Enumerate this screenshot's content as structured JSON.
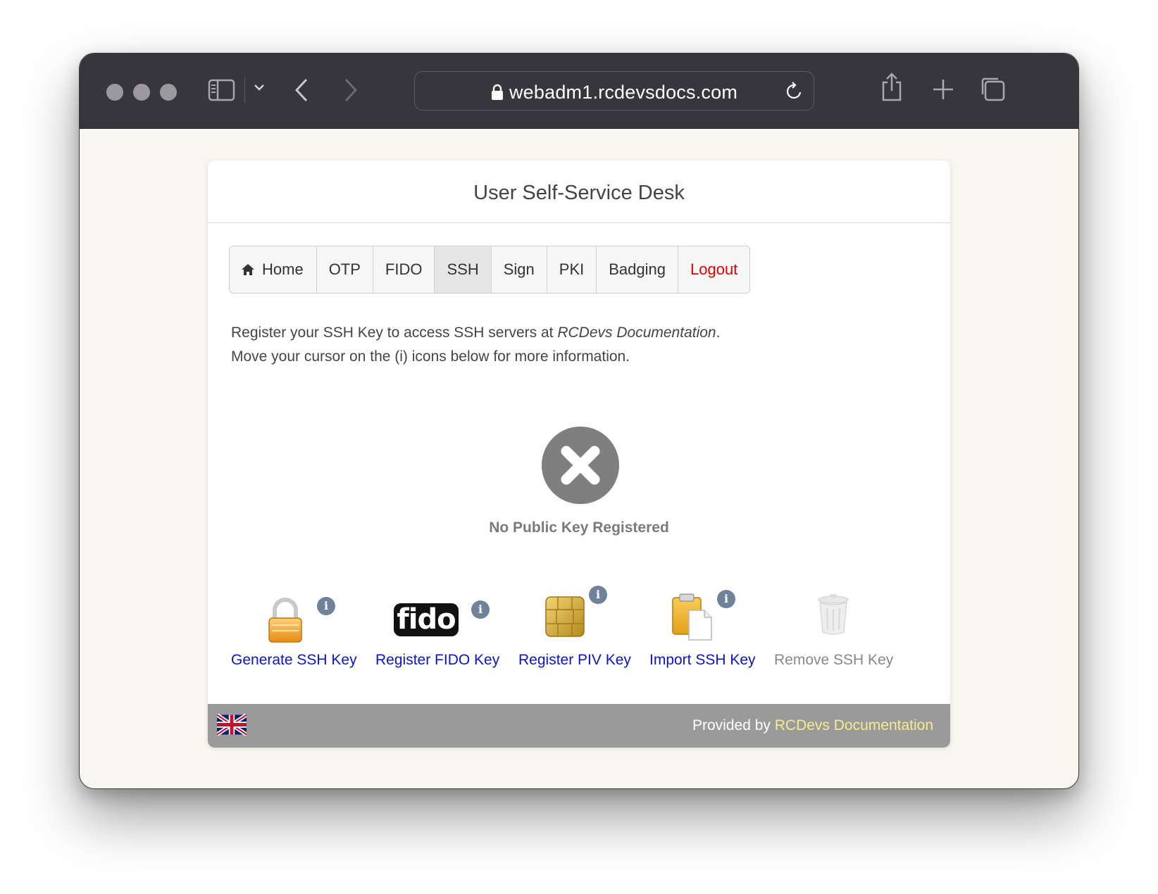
{
  "browser": {
    "url": "webadm1.rcdevsdocs.com",
    "icons": [
      "sidebar-icon",
      "chevron-down-icon",
      "back-icon",
      "forward-icon",
      "lock-icon",
      "reload-icon",
      "share-icon",
      "new-tab-icon",
      "tabs-overview-icon"
    ]
  },
  "page": {
    "title": "User Self-Service Desk",
    "tabs": [
      {
        "label": "Home",
        "icon": "home-icon"
      },
      {
        "label": "OTP"
      },
      {
        "label": "FIDO"
      },
      {
        "label": "SSH",
        "active": true
      },
      {
        "label": "Sign"
      },
      {
        "label": "PKI"
      },
      {
        "label": "Badging"
      },
      {
        "label": "Logout",
        "color": "#e00000"
      }
    ],
    "intro_line1_prefix": "Register your SSH Key to access SSH servers at ",
    "intro_line1_org": "RCDevs Documentation",
    "intro_line1_suffix": ".",
    "intro_line2": "Move your cursor on the (i) icons below for more information.",
    "status": "No Public Key Registered",
    "actions": [
      {
        "label": "Generate SSH Key",
        "icon": "padlock-icon",
        "enabled": true,
        "info": "i"
      },
      {
        "label": "Register FIDO Key",
        "icon": "fido-logo-icon",
        "icon_text": "fido",
        "enabled": true,
        "info": "i"
      },
      {
        "label": "Register PIV Key",
        "icon": "smartcard-chip-icon",
        "enabled": true,
        "info": "i"
      },
      {
        "label": "Import SSH Key",
        "icon": "clipboard-icon",
        "enabled": true,
        "info": "i"
      },
      {
        "label": "Remove SSH Key",
        "icon": "trash-icon",
        "enabled": false
      }
    ],
    "footer": {
      "prefix": "Provided by ",
      "link": "RCDevs Documentation",
      "language_icon": "uk-flag-icon"
    },
    "colors": {
      "link": "#0a14d0",
      "logout": "#e00000",
      "footer_bg": "#9a9a9a",
      "footer_link": "#f7ec8d"
    }
  }
}
